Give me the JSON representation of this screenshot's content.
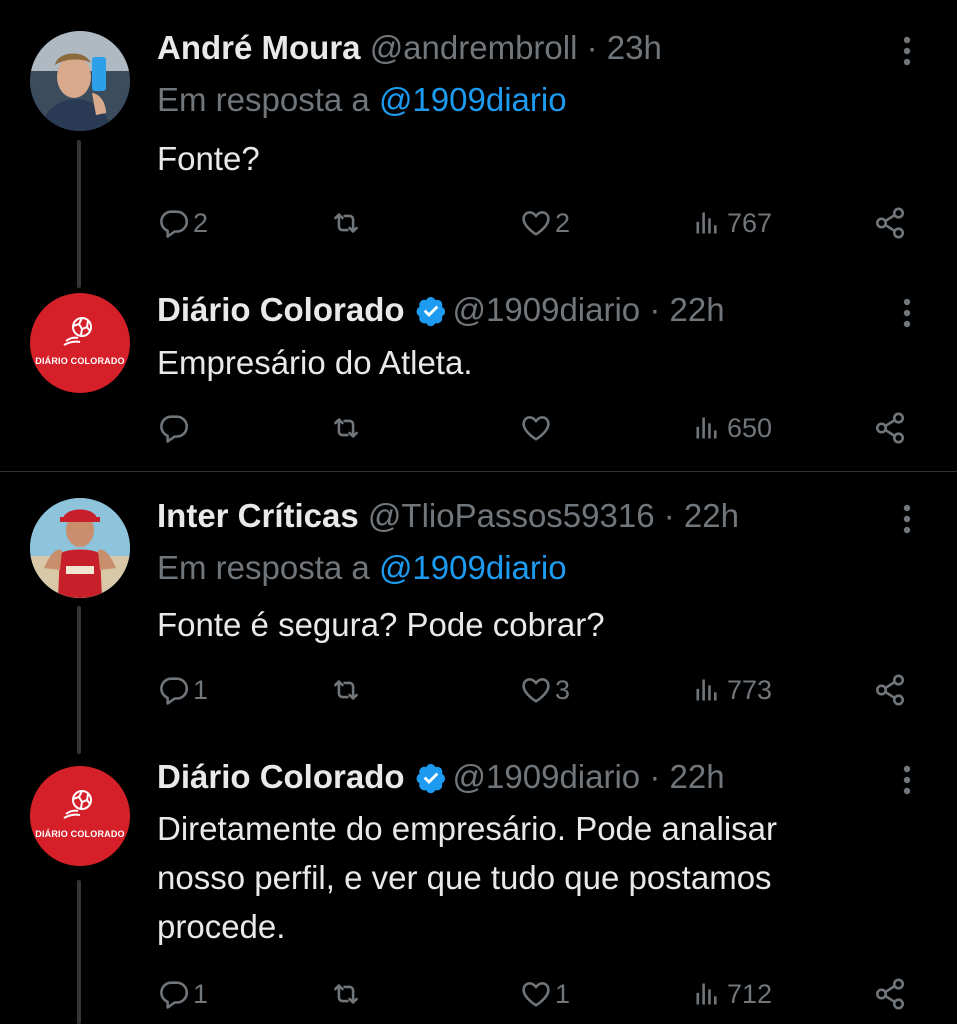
{
  "colors": {
    "background": "#000000",
    "text": "#e7e9ea",
    "muted": "#71767b",
    "accent": "#1d9bf0",
    "brand_red": "#d5202a"
  },
  "icons": {
    "reply": "reply-icon",
    "retweet": "retweet-icon",
    "like": "heart-icon",
    "views": "views-icon",
    "share": "share-icon",
    "more": "more-vertical-icon",
    "verified": "verified-badge-icon"
  },
  "tweets": [
    {
      "name": "André Moura",
      "handle": "@andrembroll",
      "dot": "·",
      "time": "23h",
      "reply_prefix": "Em resposta a ",
      "reply_to": "@1909diario",
      "lines": [
        "Fonte?"
      ],
      "replies": "2",
      "retweets": "",
      "likes": "2",
      "views": "767"
    },
    {
      "name": "Diário Colorado",
      "handle": "@1909diario",
      "dot": "·",
      "time": "22h",
      "verified": true,
      "avatar_label": "DIÁRIO COLORADO",
      "lines": [
        "Empresário do Atleta."
      ],
      "replies": "",
      "retweets": "",
      "likes": "",
      "views": "650"
    },
    {
      "name": "Inter Críticas",
      "handle": "@TlioPassos59316",
      "dot": "·",
      "time": "22h",
      "reply_prefix": "Em resposta a ",
      "reply_to": "@1909diario",
      "lines": [
        "Fonte é segura? Pode cobrar?"
      ],
      "replies": "1",
      "retweets": "",
      "likes": "3",
      "views": "773"
    },
    {
      "name": "Diário Colorado",
      "handle": "@1909diario",
      "dot": "·",
      "time": "22h",
      "verified": true,
      "avatar_label": "DIÁRIO COLORADO",
      "lines": [
        "Diretamente do empresário. Pode analisar",
        "nosso perfil, e ver que tudo que postamos",
        "procede."
      ],
      "replies": "1",
      "retweets": "",
      "likes": "1",
      "views": "712"
    }
  ]
}
